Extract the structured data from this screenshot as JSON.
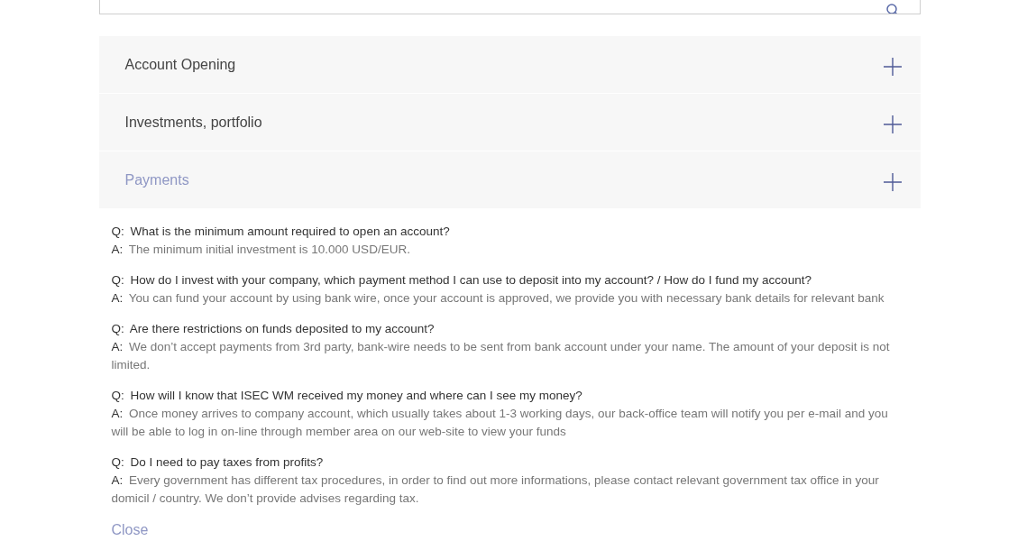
{
  "sections": [
    {
      "title": "Account Opening",
      "selected": false
    },
    {
      "title": "Investments, portfolio",
      "selected": false
    },
    {
      "title": "Payments",
      "selected": true
    }
  ],
  "faq": [
    {
      "q_label": "Q:",
      "question": "What is the minimum amount required to open an account?",
      "a_label": "A:",
      "answer": "The minimum initial investment is 10.000 USD/EUR."
    },
    {
      "q_label": "Q:",
      "question": "How do I invest with your company, which payment method I can use to deposit into my account? / How do I fund my account?",
      "a_label": "A:",
      "answer": "You can fund your account by using bank wire, once your account is approved, we provide you with necessary bank details for relevant bank"
    },
    {
      "q_label": "Q:",
      "question": "Are there restrictions on funds deposited to my account?",
      "a_label": "A:",
      "answer": "We don’t accept payments from 3rd party, bank-wire needs to be sent from bank account under your name. The amount of your deposit is not limited."
    },
    {
      "q_label": "Q:",
      "question": "How will I know that ISEC WM received my money and where can I see my money?",
      "a_label": "A:",
      "answer": "Once money arrives to company account, which usually takes about 1-3 working days, our back-office team will notify you per e-mail and you will be able to log in on-line through member area on our web-site to view your funds"
    },
    {
      "q_label": "Q:",
      "question": "Do I need to pay taxes from profits?",
      "a_label": "A:",
      "answer": "Every government has different tax procedures, in order to find out more informations, please contact relevant government tax office in your domicil / country. We don’t provide advises regarding tax."
    }
  ],
  "close_link": "Close"
}
